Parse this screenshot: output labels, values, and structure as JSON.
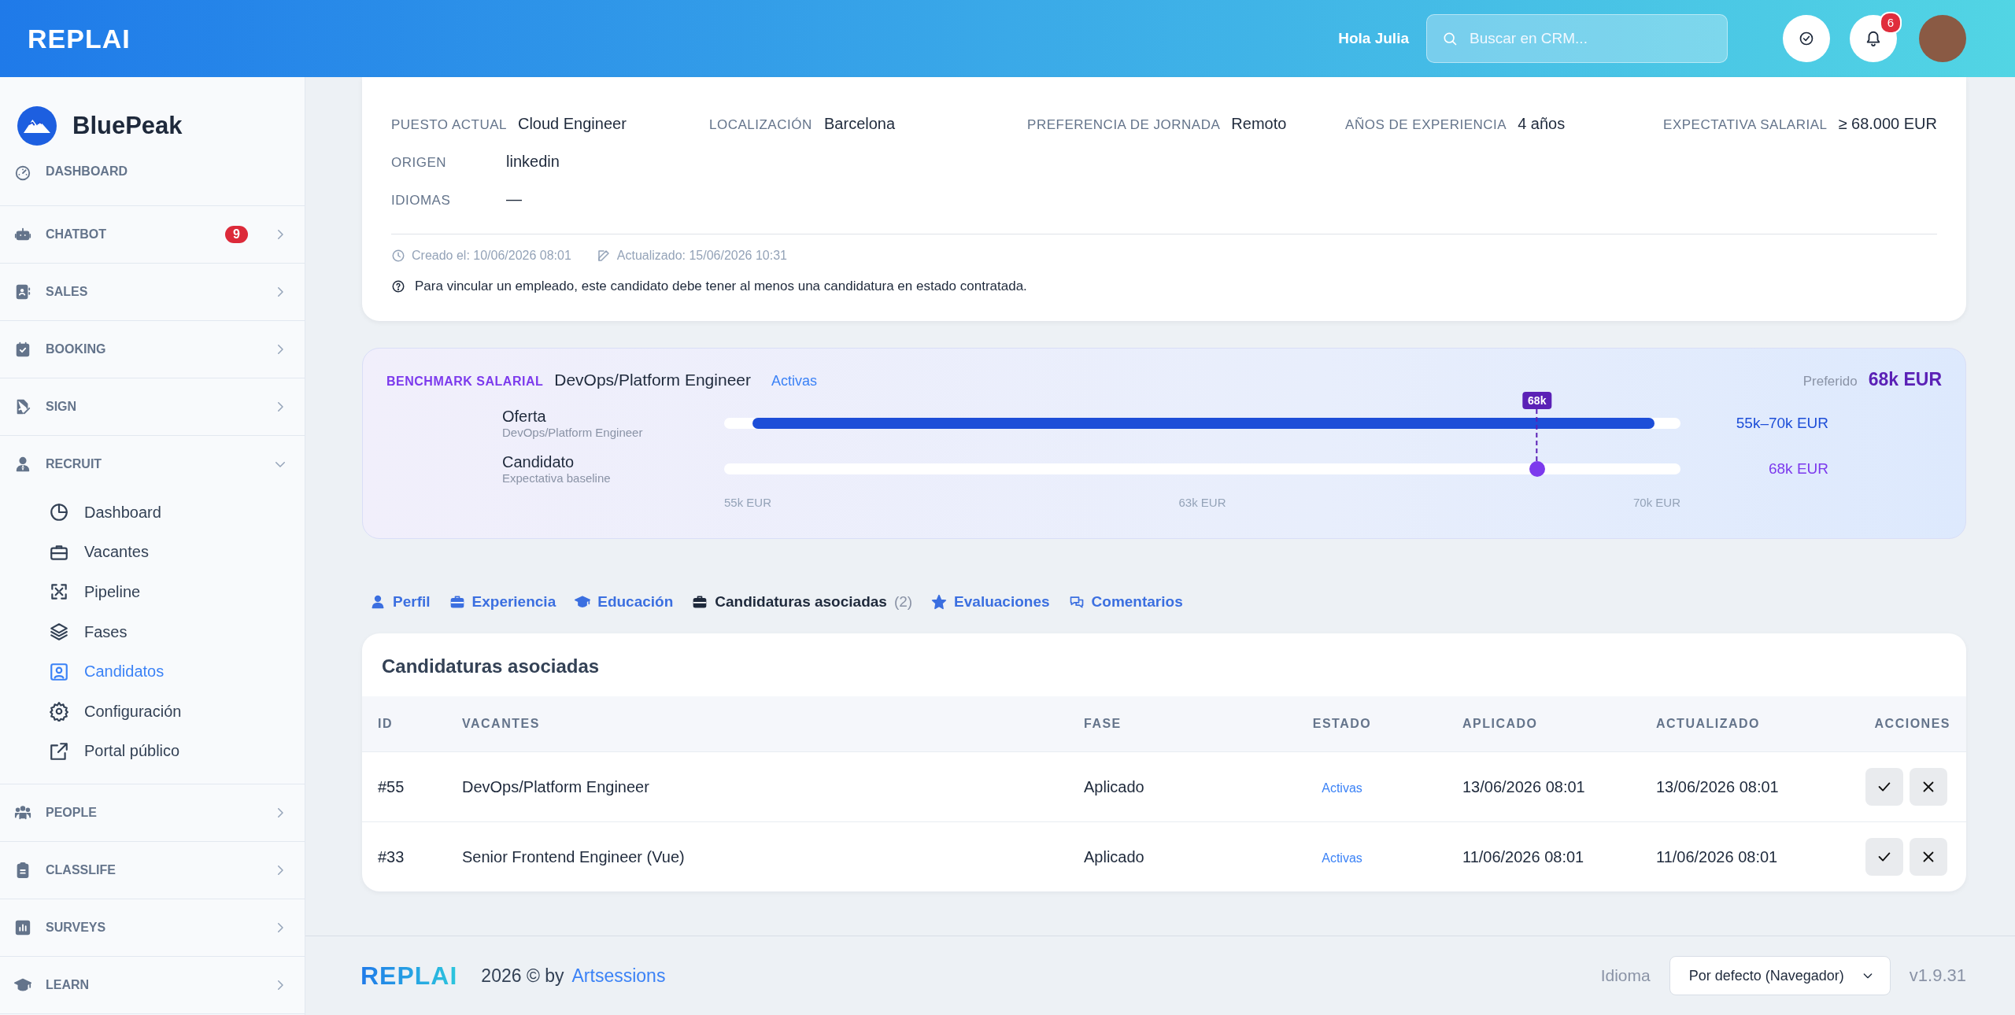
{
  "header": {
    "logo": "REPLAI",
    "greeting": "Hola Julia",
    "search": {
      "placeholder": "Buscar en CRM..."
    },
    "notifications": "6"
  },
  "sidebar": {
    "brand": "BluePeak",
    "items": [
      {
        "label": "DASHBOARD"
      },
      {
        "label": "CHATBOT",
        "badge": "9",
        "expanded": false
      },
      {
        "label": "SALES",
        "expanded": false
      },
      {
        "label": "BOOKING",
        "expanded": false
      },
      {
        "label": "SIGN",
        "expanded": false
      },
      {
        "label": "RECRUIT",
        "expanded": true,
        "children": [
          {
            "label": "Dashboard",
            "selected": false
          },
          {
            "label": "Vacantes",
            "selected": false
          },
          {
            "label": "Pipeline",
            "selected": false
          },
          {
            "label": "Fases",
            "selected": false
          },
          {
            "label": "Candidatos",
            "selected": true
          },
          {
            "label": "Configuración",
            "selected": false
          },
          {
            "label": "Portal público",
            "selected": false
          }
        ]
      },
      {
        "label": "PEOPLE",
        "expanded": false
      },
      {
        "label": "CLASSLIFE",
        "expanded": false
      },
      {
        "label": "SURVEYS",
        "expanded": false
      },
      {
        "label": "LEARN",
        "expanded": false
      }
    ]
  },
  "candidate_card": {
    "rows": [
      [
        {
          "label": "PUESTO ACTUAL",
          "value": "Cloud Engineer"
        },
        {
          "label": "LOCALIZACIÓN",
          "value": "Barcelona"
        },
        {
          "label": "PREFERENCIA DE JORNADA",
          "value": "Remoto"
        },
        {
          "label": "AÑOS DE EXPERIENCIA",
          "value": "4 años"
        },
        {
          "label": "EXPECTATIVA SALARIAL",
          "value": "≥ 68.000 EUR"
        }
      ],
      [
        {
          "label": "ORIGEN",
          "value": "linkedin"
        }
      ],
      [
        {
          "label": "IDIOMAS",
          "value": "—"
        }
      ]
    ],
    "created": "Creado el: 10/06/2026 08:01",
    "updated": "Actualizado: 15/06/2026 10:31",
    "note": "Para vincular un empleado, este candidato debe tener al menos una candidatura en estado contratada."
  },
  "benchmark": {
    "label": "BENCHMARK SALARIAL",
    "title": "DevOps/Platform Engineer",
    "status": "Activas",
    "preferred_label": "Preferido",
    "preferred_value": "68k EUR",
    "rows": [
      {
        "kind": "range",
        "label": "Oferta",
        "sublabel": "DevOps/Platform Engineer",
        "reading": "55k–70k EUR"
      },
      {
        "kind": "point",
        "label": "Candidato",
        "sublabel": "Expectativa baseline",
        "reading": "68k EUR",
        "level": 0.85,
        "marker": "68k"
      }
    ],
    "axis": [
      "55k EUR",
      "63k EUR",
      "70k EUR"
    ]
  },
  "tabs": [
    {
      "label": "Perfil",
      "selected": false
    },
    {
      "label": "Experiencia",
      "selected": false
    },
    {
      "label": "Educación",
      "selected": false
    },
    {
      "label": "Candidaturas asociadas",
      "count": "(2)",
      "selected": true
    },
    {
      "label": "Evaluaciones",
      "selected": false
    },
    {
      "label": "Comentarios",
      "selected": false
    }
  ],
  "table": {
    "title": "Candidaturas asociadas",
    "columns": [
      "ID",
      "VACANTES",
      "FASE",
      "ESTADO",
      "APLICADO",
      "ACTUALIZADO",
      "ACCIONES"
    ],
    "rows": [
      {
        "id": "#55",
        "vacante": "DevOps/Platform Engineer",
        "fase": "Aplicado",
        "estado": "Activas",
        "aplicado": "13/06/2026 08:01",
        "actualizado": "13/06/2026 08:01"
      },
      {
        "id": "#33",
        "vacante": "Senior Frontend Engineer (Vue)",
        "fase": "Aplicado",
        "estado": "Activas",
        "aplicado": "11/06/2026 08:01",
        "actualizado": "11/06/2026 08:01"
      }
    ]
  },
  "footer": {
    "logo": "REPLAI",
    "copyright": "2026 © by",
    "link": "Artsessions",
    "language_label": "Idioma",
    "language_value": "Por defecto (Navegador)",
    "version": "v1.9.31"
  }
}
